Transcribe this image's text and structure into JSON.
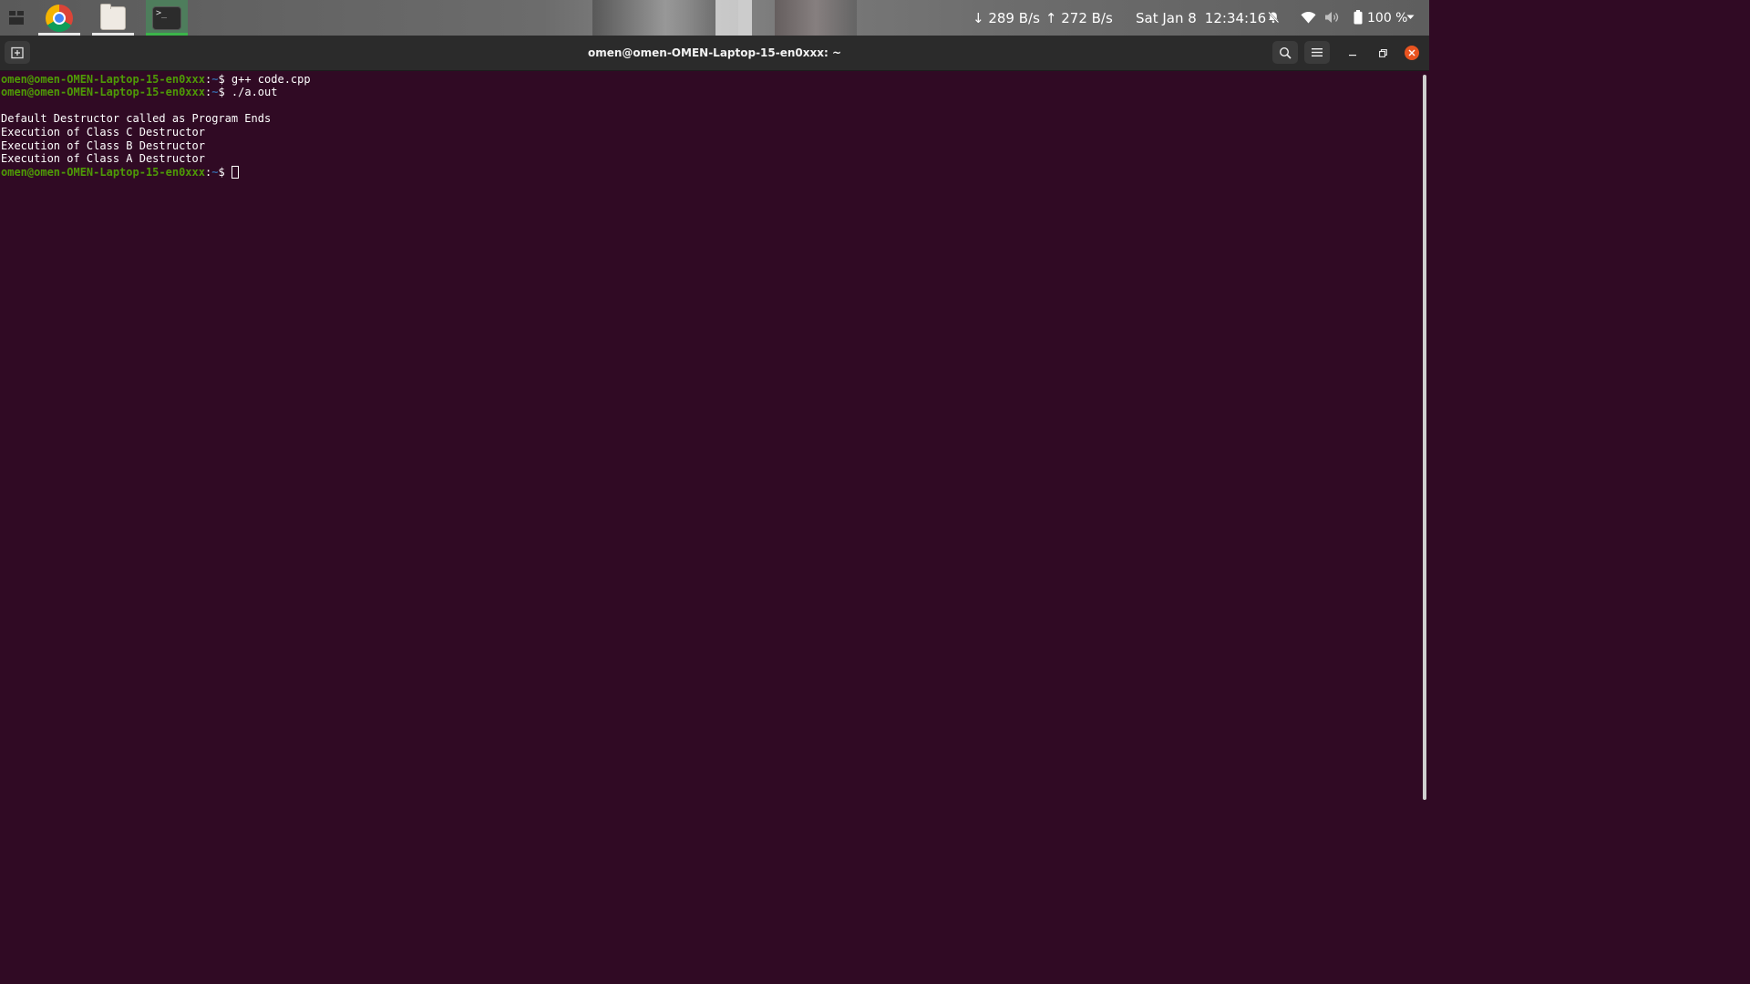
{
  "topbar": {
    "apps": [
      {
        "name": "Google Chrome",
        "icon": "chrome-icon"
      },
      {
        "name": "Files",
        "icon": "files-icon"
      },
      {
        "name": "Terminal",
        "icon": "terminal-icon",
        "active": true
      }
    ],
    "network_down": "↓ 289 B/s",
    "network_up": "↑ 272 B/s",
    "date": "Sat Jan 8",
    "time": "12:34:16",
    "battery_percent": "100 %",
    "status_icons": [
      "bell-muted-icon",
      "wifi-icon",
      "speaker-icon",
      "battery-icon"
    ]
  },
  "window": {
    "title": "omen@omen-OMEN-Laptop-15-en0xxx: ~",
    "buttons": [
      "new-tab-icon",
      "search-icon",
      "hamburger-menu-icon",
      "minimize-icon",
      "maximize-icon",
      "close-icon"
    ]
  },
  "terminal": {
    "lines": [
      {
        "user": "omen@omen-OMEN-Laptop-15-en0xxx",
        "sep": ":",
        "path": "~",
        "sym": "$ ",
        "cmd": "g++ code.cpp"
      },
      {
        "user": "omen@omen-OMEN-Laptop-15-en0xxx",
        "sep": ":",
        "path": "~",
        "sym": "$ ",
        "cmd": "./a.out"
      },
      {
        "text": ""
      },
      {
        "text": "Default Destructor called as Program Ends"
      },
      {
        "text": "Execution of Class C Destructor"
      },
      {
        "text": "Execution of Class B Destructor"
      },
      {
        "text": "Execution of Class A Destructor"
      },
      {
        "user": "omen@omen-OMEN-Laptop-15-en0xxx",
        "sep": ":",
        "path": "~",
        "sym": "$ ",
        "cmd": ""
      }
    ]
  },
  "colors": {
    "terminal_bg": "#300a24",
    "prompt_user": "#4e9a06",
    "prompt_path": "#3465a4",
    "close_button": "#e95420",
    "active_app_indicator": "#3bb54a"
  }
}
